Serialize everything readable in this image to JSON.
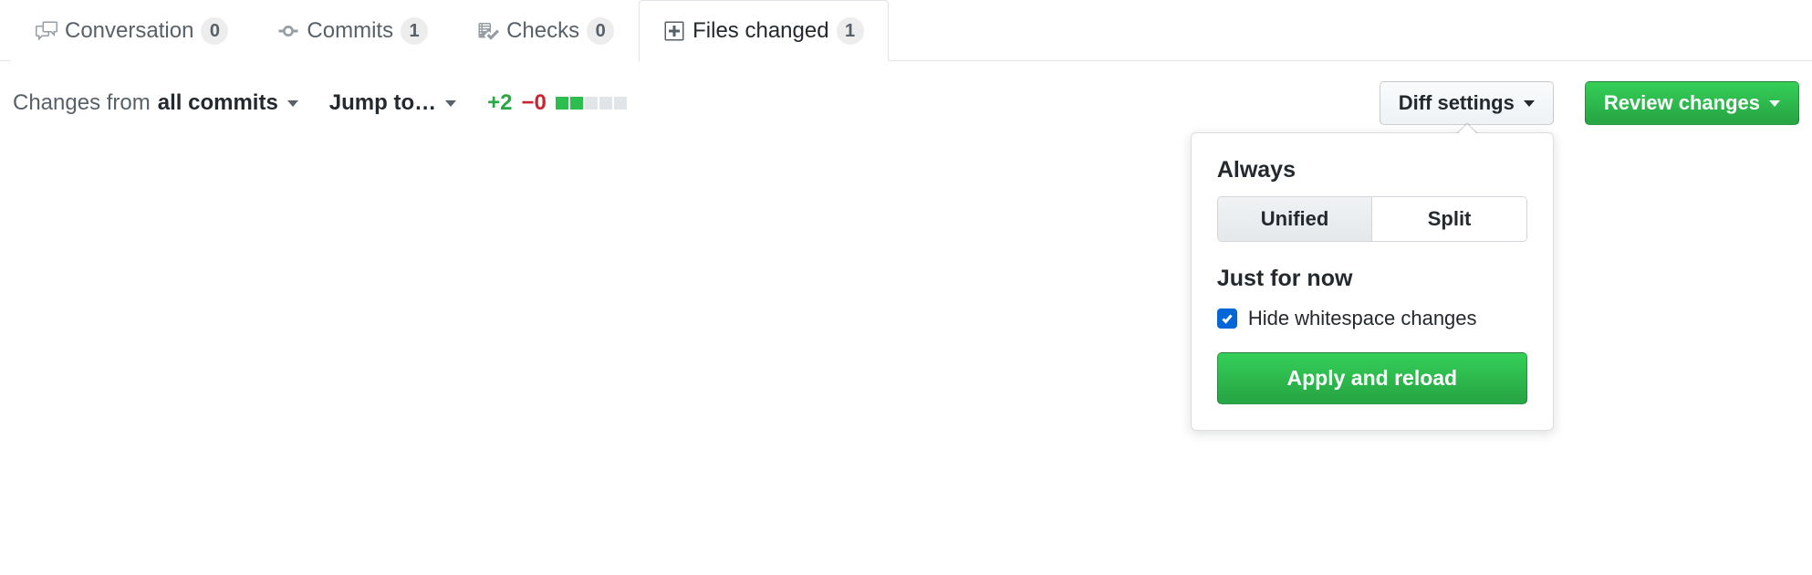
{
  "tabs": {
    "conversation": {
      "label": "Conversation",
      "count": "0"
    },
    "commits": {
      "label": "Commits",
      "count": "1"
    },
    "checks": {
      "label": "Checks",
      "count": "0"
    },
    "files": {
      "label": "Files changed",
      "count": "1"
    }
  },
  "toolbar": {
    "changes_from_prefix": "Changes from",
    "changes_from_value": "all commits",
    "jump_to": "Jump to…",
    "additions": "+2",
    "deletions": "−0",
    "diff_settings": "Diff settings",
    "review_changes": "Review changes"
  },
  "popover": {
    "always_heading": "Always",
    "unified": "Unified",
    "split": "Split",
    "just_for_now_heading": "Just for now",
    "hide_whitespace": "Hide whitespace changes",
    "apply": "Apply and reload"
  }
}
